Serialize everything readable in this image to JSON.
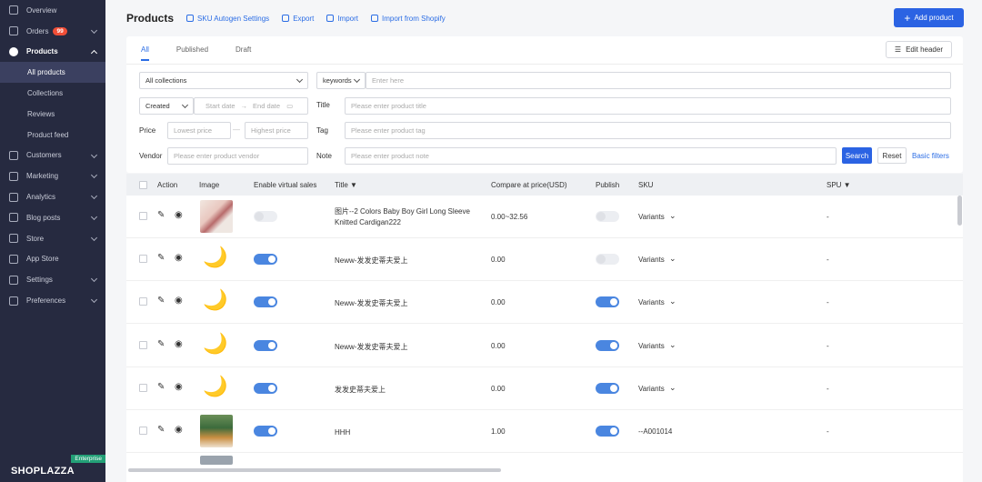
{
  "sidebar": {
    "items": [
      {
        "label": "Overview",
        "icon": "overview-icon"
      },
      {
        "label": "Orders",
        "icon": "orders-icon",
        "badge": "99"
      },
      {
        "label": "Products",
        "icon": "products-icon"
      },
      {
        "label": "Customers",
        "icon": "customers-icon"
      },
      {
        "label": "Marketing",
        "icon": "marketing-icon"
      },
      {
        "label": "Analytics",
        "icon": "analytics-icon"
      },
      {
        "label": "Blog posts",
        "icon": "blog-icon"
      },
      {
        "label": "Store",
        "icon": "store-icon"
      },
      {
        "label": "App Store",
        "icon": "app-store-icon"
      },
      {
        "label": "Settings",
        "icon": "settings-icon"
      },
      {
        "label": "Preferences",
        "icon": "preferences-icon"
      }
    ],
    "products_sub": [
      "All products",
      "Collections",
      "Reviews",
      "Product feed"
    ],
    "brand": "SHOPLAZZA",
    "edition": "Enterprise"
  },
  "header": {
    "title": "Products",
    "links": [
      "SKU Autogen Settings",
      "Export",
      "Import",
      "Import from Shopify"
    ],
    "add_button": "Add product"
  },
  "tabs": [
    "All",
    "Published",
    "Draft"
  ],
  "edit_header": "Edit header",
  "filters": {
    "collections": "All collections",
    "keywords": "keywords",
    "keywords_placeholder": "Enter here",
    "created": "Created",
    "start_date": "Start date",
    "end_date": "End date",
    "title_label": "Title",
    "title_placeholder": "Please enter product title",
    "price_label": "Price",
    "lowest_price": "Lowest price",
    "price_sep": "—",
    "highest_price": "Highest price",
    "tag_label": "Tag",
    "tag_placeholder": "Please enter product tag",
    "vendor_label": "Vendor",
    "vendor_placeholder": "Please enter product vendor",
    "note_label": "Note",
    "note_placeholder": "Please enter product note",
    "search": "Search",
    "reset": "Reset",
    "basic_filters": "Basic filters"
  },
  "table": {
    "columns": [
      "Action",
      "Image",
      "Enable virtual sales",
      "Title ▼",
      "Compare at price(USD)",
      "Publish",
      "SKU",
      "SPU ▼"
    ],
    "rows": [
      {
        "image": "photo",
        "virtual_sales": false,
        "title": "图片--2 Colors Baby Boy Girl Long Sleeve Knitted Cardigan222",
        "price": "0.00~32.56",
        "publish": false,
        "sku": "Variants",
        "spu": "-"
      },
      {
        "image": "moon",
        "virtual_sales": true,
        "title": "Neww-发发史蒂夫爱上",
        "price": "0.00",
        "publish": false,
        "sku": "Variants",
        "spu": "-"
      },
      {
        "image": "moon",
        "virtual_sales": true,
        "title": "Neww-发发史蒂夫爱上",
        "price": "0.00",
        "publish": true,
        "sku": "Variants",
        "spu": "-"
      },
      {
        "image": "moon",
        "virtual_sales": true,
        "title": "Neww-发发史蒂夫爱上",
        "price": "0.00",
        "publish": true,
        "sku": "Variants",
        "spu": "-"
      },
      {
        "image": "moon",
        "virtual_sales": true,
        "title": "发发史蒂夫爱上",
        "price": "0.00",
        "publish": true,
        "sku": "Variants",
        "spu": "-"
      },
      {
        "image": "photo",
        "virtual_sales": true,
        "title": "HHH",
        "price": "1.00",
        "publish": true,
        "sku": "--A001014",
        "spu": "-"
      }
    ]
  },
  "colors": {
    "sidebar_bg": "#262a40",
    "accent": "#2b63e3",
    "toggle_on": "#4a86e0"
  }
}
